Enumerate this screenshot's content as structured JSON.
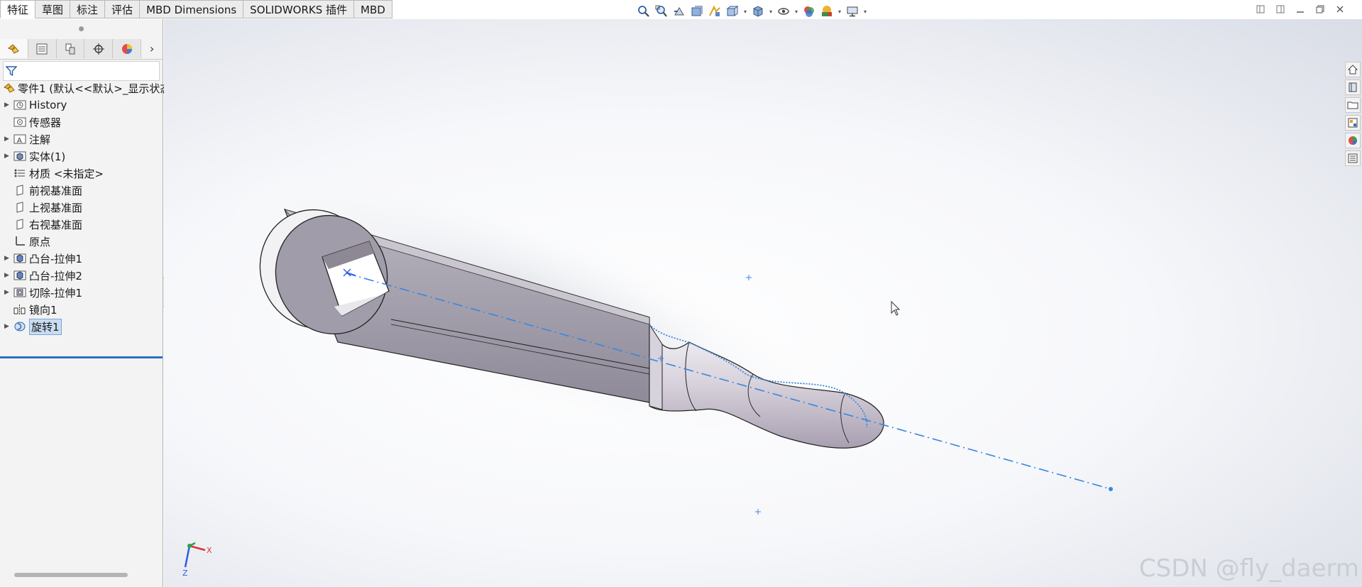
{
  "tabs": [
    "特征",
    "草图",
    "标注",
    "评估",
    "MBD Dimensions",
    "SOLIDWORKS 插件",
    "MBD"
  ],
  "active_tab": 0,
  "view_toolbar": {
    "icons": [
      "zoom-to-fit-icon",
      "zoom-to-area-icon",
      "previous-view-icon",
      "section-view-icon",
      "dynamic-annotation-icon",
      "view-orientation-icon",
      "display-style-icon",
      "hide-show-items-icon",
      "edit-appearance-icon",
      "apply-scene-icon",
      "view-settings-icon"
    ]
  },
  "feature_tree": {
    "root": "零件1 (默认<<默认>_显示状态",
    "items": [
      {
        "label": "History",
        "expandable": true,
        "icon": "history-icon"
      },
      {
        "label": "传感器",
        "expandable": false,
        "icon": "sensor-icon"
      },
      {
        "label": "注解",
        "expandable": true,
        "icon": "annotation-icon"
      },
      {
        "label": "实体(1)",
        "expandable": true,
        "icon": "solid-bodies-icon"
      },
      {
        "label": "材质 <未指定>",
        "expandable": false,
        "icon": "material-icon"
      },
      {
        "label": "前视基准面",
        "expandable": false,
        "icon": "plane-icon"
      },
      {
        "label": "上视基准面",
        "expandable": false,
        "icon": "plane-icon"
      },
      {
        "label": "右视基准面",
        "expandable": false,
        "icon": "plane-icon"
      },
      {
        "label": "原点",
        "expandable": false,
        "icon": "origin-icon"
      },
      {
        "label": "凸台-拉伸1",
        "expandable": true,
        "icon": "boss-extrude-icon"
      },
      {
        "label": "凸台-拉伸2",
        "expandable": true,
        "icon": "boss-extrude-icon"
      },
      {
        "label": "切除-拉伸1",
        "expandable": true,
        "icon": "cut-extrude-icon"
      },
      {
        "label": "镜向1",
        "expandable": false,
        "icon": "mirror-icon"
      },
      {
        "label": "旋转1",
        "expandable": true,
        "icon": "revolve-icon",
        "selected": true
      }
    ]
  },
  "triad": {
    "x_label": "X",
    "z_label": "Z"
  },
  "watermark": "CSDN @fly_daerm"
}
